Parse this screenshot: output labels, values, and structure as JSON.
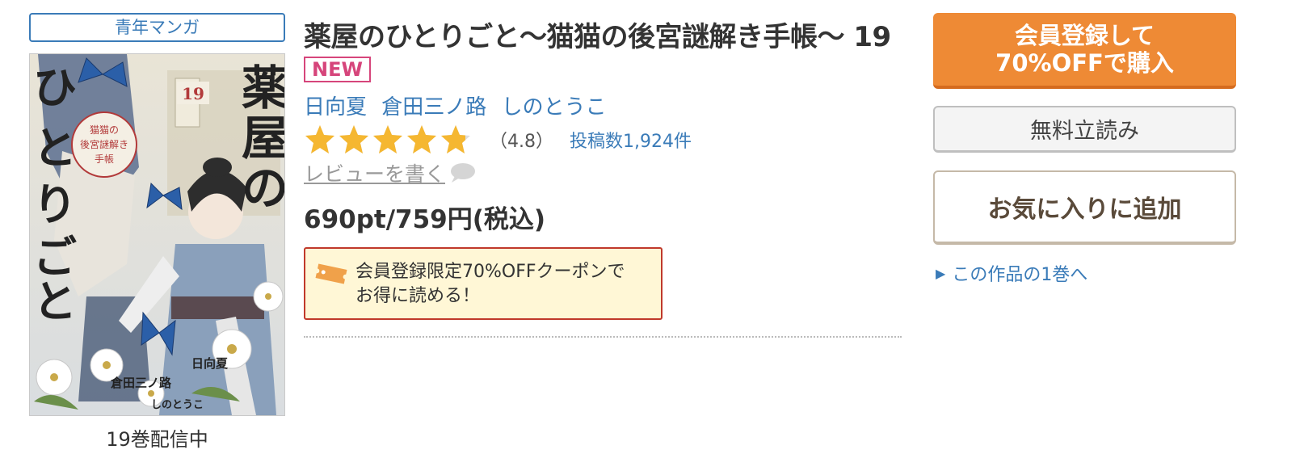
{
  "genre": {
    "label": "青年マンガ"
  },
  "book": {
    "title": "薬屋のひとりごと〜猫猫の後宮謎解き手帳〜 19",
    "badge": "NEW",
    "authors": [
      "日向夏",
      "倉田三ノ路",
      "しのとうこ"
    ],
    "rating": {
      "value": 4.8,
      "value_text": "（4.8）",
      "count_text": "投稿数1,924件",
      "max_stars": 5
    },
    "write_review": "レビューを書く",
    "price": "690pt/759円(税込)",
    "coupon": {
      "line1": "会員登録限定70%OFFクーポンで",
      "line2": "お得に読める！"
    },
    "volumes_text": "19巻配信中"
  },
  "cover": {
    "title_chars": [
      "薬",
      "屋",
      "の",
      "ひ",
      "と",
      "り",
      "ご",
      "と"
    ],
    "subtitle_line1": "猫猫の",
    "subtitle_line2": "後宮謎解き",
    "subtitle_line3": "手帳",
    "volume_number": "19",
    "credit1": "日向夏",
    "credit2": "倉田三ノ路",
    "credit3": "しのとうこ"
  },
  "actions": {
    "buy_line1": "会員登録して",
    "buy_line2": "70%OFFで購入",
    "trial": "無料立読み",
    "favorite": "お気に入りに追加",
    "first_volume": "この作品の1巻へ"
  },
  "colors": {
    "link": "#3a7bb8",
    "badge": "#d6457b",
    "buy_button": "#ee8a35",
    "star": "#f5b731",
    "coupon_border": "#c0392b",
    "coupon_bg": "#fff7d6"
  },
  "icons": {
    "stars": "star-icon",
    "review": "speech-bubble-icon",
    "coupon": "ticket-icon",
    "first_volume": "triangle-right-icon"
  }
}
